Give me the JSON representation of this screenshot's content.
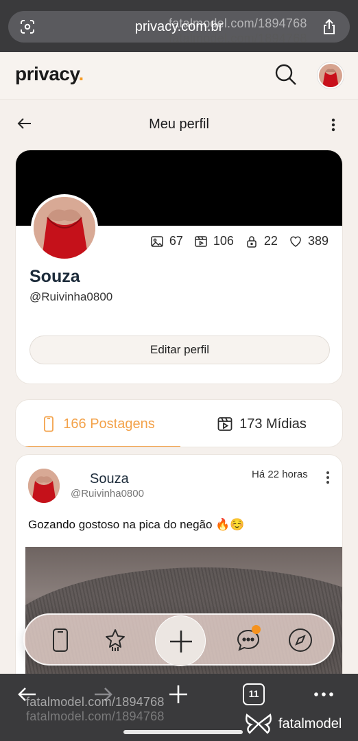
{
  "browser": {
    "url": "privacy.com.br",
    "watermark_1": "fatalmodel.com/1894768",
    "watermark_2": "fatalmodel.com/1894768",
    "watermark_3": "fatalmodel.com/1894768",
    "watermark_4": "fatalmodel.com/1894768",
    "tab_count": "11",
    "brand_logo": "fatalmodel"
  },
  "site": {
    "logo_text": "privacy",
    "logo_dot": ".",
    "accent": "#f3a24a"
  },
  "page": {
    "title": "Meu perfil"
  },
  "profile": {
    "name": "Souza",
    "handle": "@Ruivinha0800",
    "stats": {
      "photos": "67",
      "videos": "106",
      "locked": "22",
      "likes": "389"
    },
    "edit_label": "Editar perfil"
  },
  "tabs": {
    "posts_label": "166 Postagens",
    "media_label": "173 Mídias"
  },
  "post": {
    "author_name": "Souza",
    "author_handle": "@Ruivinha0800",
    "time": "Há 22 horas",
    "text": "Gozando gostoso na pica do negão 🔥☺️"
  },
  "icons": {
    "url_left": "camera-search-icon",
    "share": "share-icon",
    "search": "search-icon",
    "back": "arrow-left-icon",
    "more": "more-vertical-icon",
    "nav": [
      "phone-icon",
      "star-icon",
      "plus-icon",
      "chat-icon",
      "compass-icon"
    ]
  }
}
